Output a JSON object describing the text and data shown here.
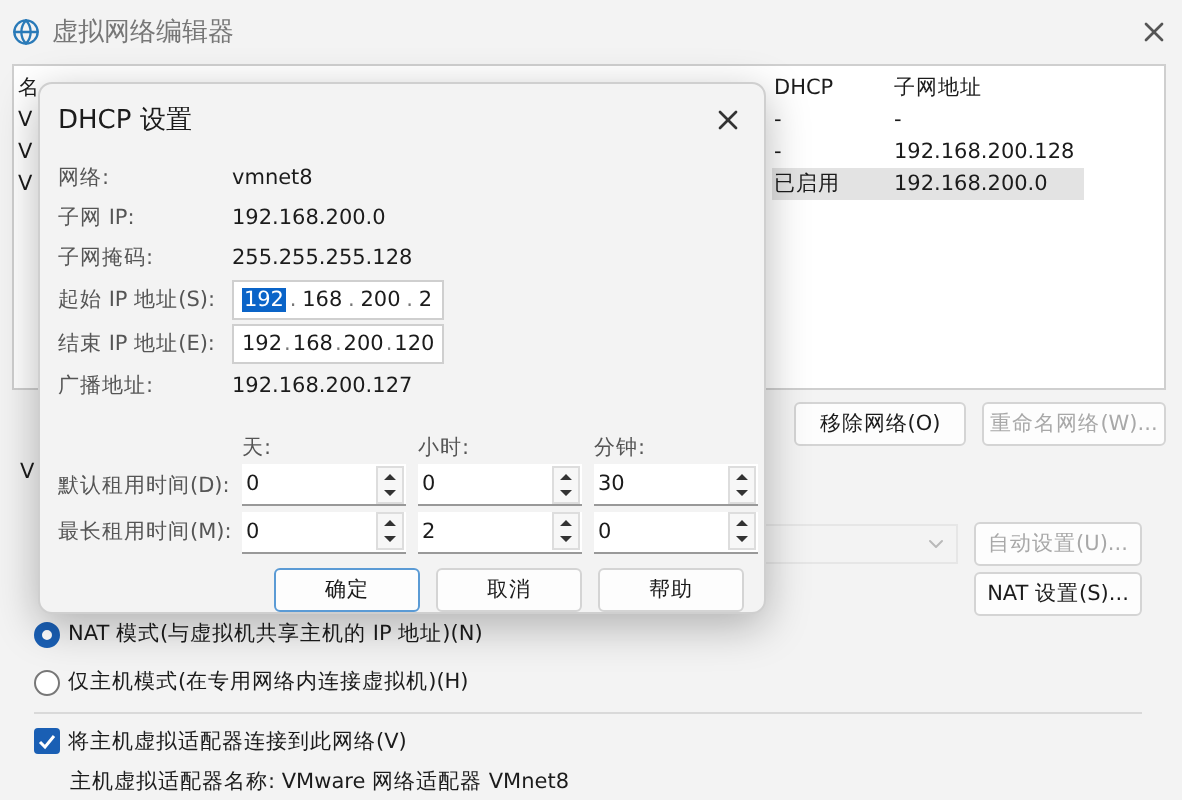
{
  "window": {
    "title": "虚拟网络编辑器"
  },
  "network_table": {
    "columns": [
      "名",
      "DHCP",
      "子网地址"
    ],
    "rows": [
      {
        "name": "V",
        "dhcp": "-",
        "subnet": "-",
        "selected": false
      },
      {
        "name": "V",
        "dhcp": "-",
        "subnet": "192.168.200.128",
        "selected": false
      },
      {
        "name": "V",
        "dhcp": "已启用",
        "subnet": "192.168.200.0",
        "selected": true
      }
    ]
  },
  "network_buttons": [
    {
      "label": "移除网络(O)",
      "disabled": false
    },
    {
      "label": "重命名网络(W)...",
      "disabled": true
    }
  ],
  "info_group": {
    "title": "V"
  },
  "bridge_select": {
    "disabled": true
  },
  "auto_button": {
    "label": "自动设置(U)...",
    "disabled": true
  },
  "nat_button": {
    "label": "NAT 设置(S)...",
    "disabled": false
  },
  "modes": [
    {
      "label": "NAT 模式(与虚拟机共享主机的 IP 地址)(N)",
      "selected": true
    },
    {
      "label": "仅主机模式(在专用网络内连接虚拟机)(H)",
      "selected": false
    }
  ],
  "adapter": {
    "label": "将主机虚拟适配器连接到此网络(V)",
    "checked": true,
    "name_line": "主机虚拟适配器名称: VMware 网络适配器 VMnet8"
  },
  "dialog": {
    "title": "DHCP 设置",
    "rows": [
      {
        "kind": "text",
        "label": "网络:",
        "value": "vmnet8"
      },
      {
        "kind": "text",
        "label": "子网 IP:",
        "value": "192.168.200.0"
      },
      {
        "kind": "text",
        "label": "子网掩码:",
        "value": "255.255.255.128"
      },
      {
        "kind": "ip",
        "label": "起始 IP 地址(S):",
        "separator": ".",
        "octets": [
          {
            "text": "192",
            "selected": true
          },
          {
            "text": "168",
            "selected": false
          },
          {
            "text": "200",
            "selected": false
          },
          {
            "text": "2",
            "selected": false
          }
        ]
      },
      {
        "kind": "ip",
        "label": "结束 IP 地址(E):",
        "separator": ".",
        "octets": [
          {
            "text": "192",
            "selected": false
          },
          {
            "text": "168",
            "selected": false
          },
          {
            "text": "200",
            "selected": false
          },
          {
            "text": "120",
            "selected": false
          }
        ]
      },
      {
        "kind": "text",
        "label": "广播地址:",
        "value": "192.168.200.127"
      }
    ],
    "lease_headers": [
      "天:",
      "小时:",
      "分钟:"
    ],
    "lease_rows": [
      {
        "label": "默认租用时间(D):",
        "values": [
          "0",
          "0",
          "30"
        ]
      },
      {
        "label": "最长租用时间(M):",
        "values": [
          "0",
          "2",
          "0"
        ]
      }
    ],
    "buttons": [
      {
        "label": "确定",
        "default": true
      },
      {
        "label": "取消",
        "default": false
      },
      {
        "label": "帮助",
        "default": false
      }
    ]
  }
}
